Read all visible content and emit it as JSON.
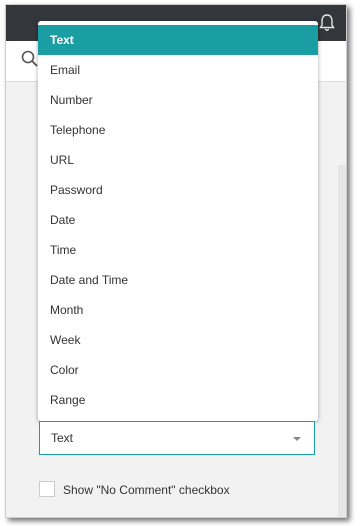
{
  "header": {
    "icon": "bell-icon"
  },
  "search": {
    "icon": "search-icon"
  },
  "dropdown": {
    "items": [
      {
        "label": "Text",
        "selected": true
      },
      {
        "label": "Email"
      },
      {
        "label": "Number"
      },
      {
        "label": "Telephone"
      },
      {
        "label": "URL"
      },
      {
        "label": "Password"
      },
      {
        "label": "Date"
      },
      {
        "label": "Time"
      },
      {
        "label": "Date and Time"
      },
      {
        "label": "Month"
      },
      {
        "label": "Week"
      },
      {
        "label": "Color"
      },
      {
        "label": "Range"
      }
    ]
  },
  "field": {
    "value": "Text"
  },
  "no_comment": {
    "label": "Show \"No Comment\" checkbox",
    "checked": false
  },
  "colors": {
    "accent": "#1a9ea3",
    "topbar": "#33373b"
  }
}
